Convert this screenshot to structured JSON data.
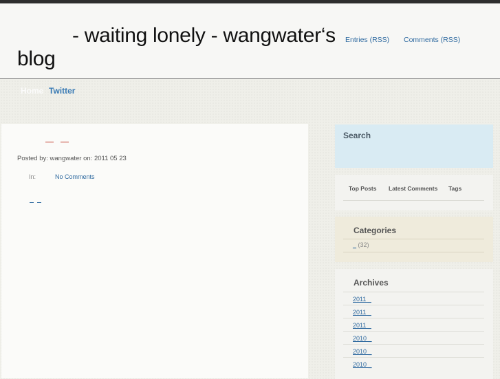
{
  "header": {
    "title": "- waiting lonely - wangwater‘s blog",
    "feeds": {
      "entries": "Entries (RSS)",
      "comments": "Comments (RSS)"
    }
  },
  "nav": {
    "home": "Home",
    "twitter": "Twitter"
  },
  "post": {
    "meta": "Posted by: wangwater on: 2011 05 23",
    "in_label": "In:",
    "comments_link": "No Comments"
  },
  "sidebar": {
    "search_title": "Search",
    "tabs": {
      "top_posts": "Top Posts",
      "latest_comments": "Latest Comments",
      "tags": "Tags"
    },
    "categories": {
      "title": "Categories",
      "items": [
        {
          "label": "_",
          "count": "(32)"
        }
      ]
    },
    "archives": {
      "title": "Archives",
      "items": [
        "2011 _",
        "2011 _",
        "2011 _",
        "2010 _",
        "2010 _",
        "2010 _"
      ]
    }
  },
  "colors": {
    "link": "#2f6aa0",
    "search_bg": "#d9ebf3",
    "categories_bg": "#efebdc",
    "topbar": "#2e2e2e"
  }
}
